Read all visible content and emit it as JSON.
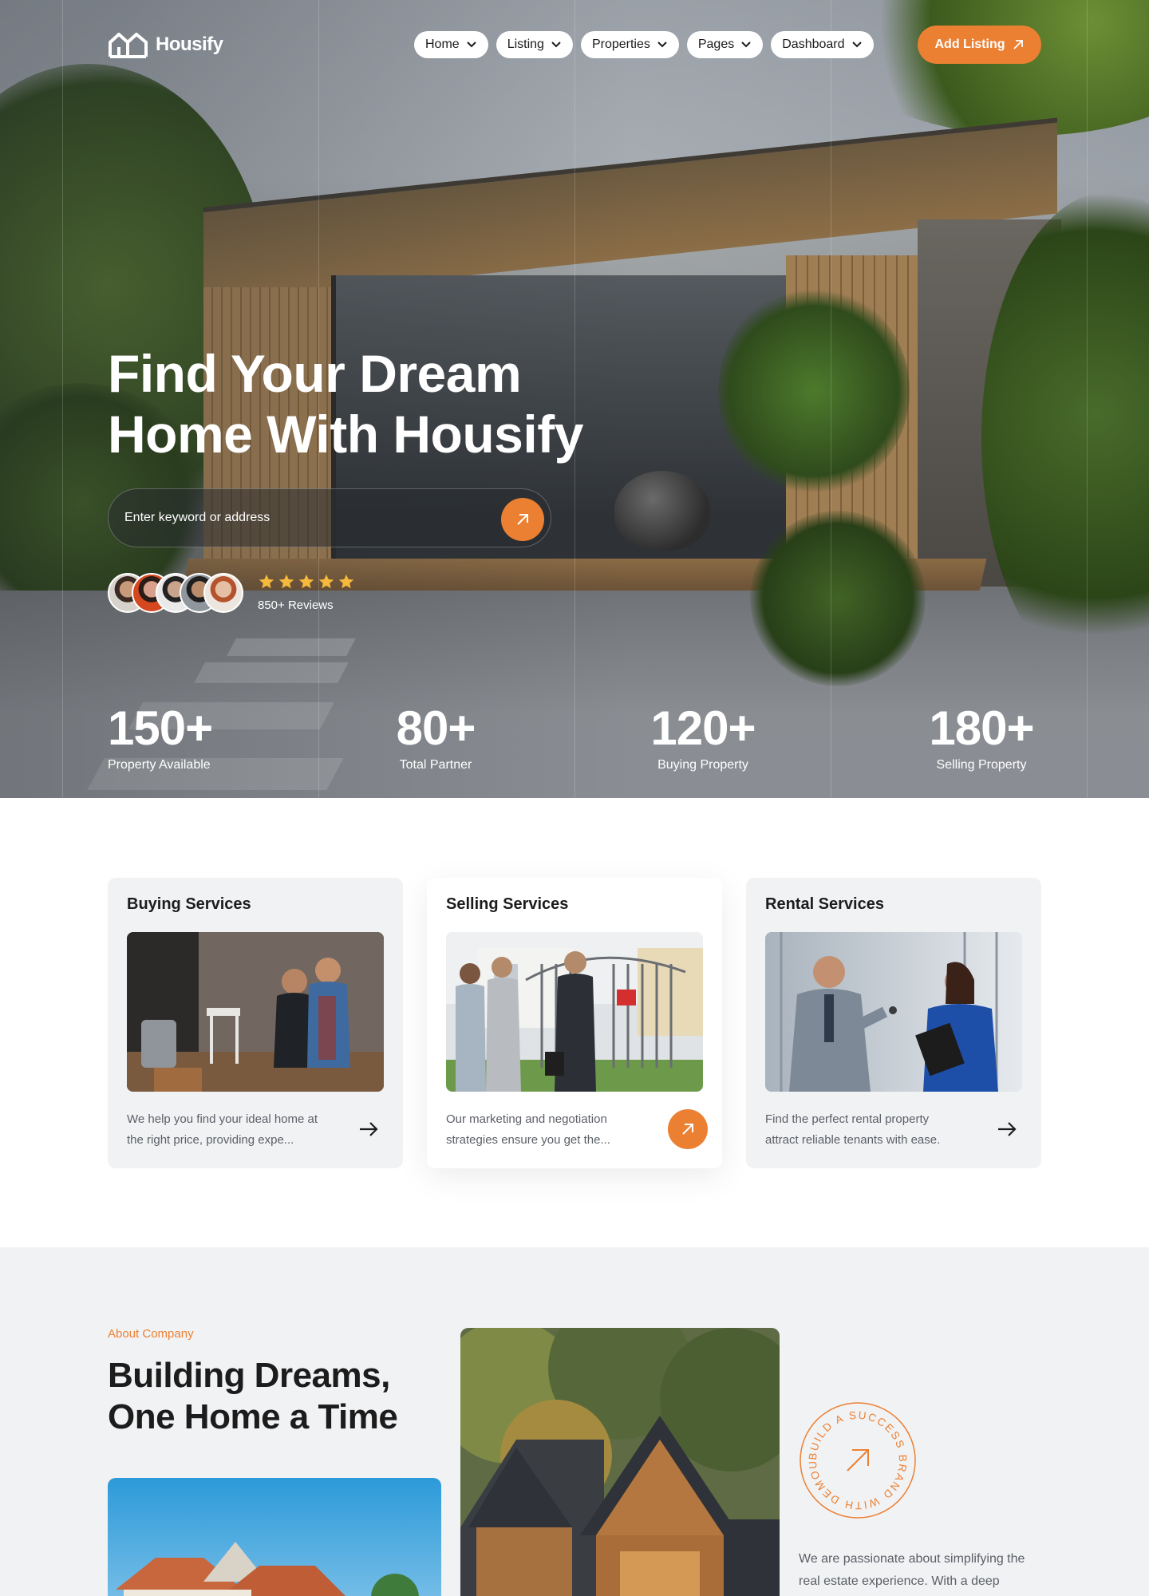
{
  "brand": {
    "name": "Housify",
    "accent": "#ec8032"
  },
  "nav": {
    "items": [
      {
        "label": "Home"
      },
      {
        "label": "Listing"
      },
      {
        "label": "Properties"
      },
      {
        "label": "Pages"
      },
      {
        "label": "Dashboard"
      }
    ],
    "cta_label": "Add Listing"
  },
  "hero": {
    "title_line1": "Find Your Dream",
    "title_line2": "Home With Housify",
    "search_placeholder": "Enter keyword or address",
    "rating_stars": 5,
    "reviews_label": "850+ Reviews"
  },
  "stats": [
    {
      "value": "150+",
      "label": "Property Available"
    },
    {
      "value": "80+",
      "label": "Total Partner"
    },
    {
      "value": "120+",
      "label": "Buying Property"
    },
    {
      "value": "180+",
      "label": "Selling Property"
    }
  ],
  "services": [
    {
      "title": "Buying Services",
      "text_line1": "We help you find your ideal home at",
      "text_line2": "the right price, providing expe...",
      "icon": "arrow-right-icon"
    },
    {
      "title": "Selling Services",
      "text_line1": "Our marketing and negotiation",
      "text_line2": "strategies ensure you get the...",
      "icon": "arrow-up-right-icon"
    },
    {
      "title": "Rental Services",
      "text_line1": "Find the perfect rental property",
      "text_line2": "attract reliable tenants with ease.",
      "icon": "arrow-right-icon"
    }
  ],
  "about": {
    "eyebrow": "About Company",
    "title_line1": "Building Dreams,",
    "title_line2": "One Home a Time",
    "badge_text": "BUILD A SUCCESS BRAND WITH DEMOUI",
    "text_line1": "We are passionate about simplifying the",
    "text_line2": "real estate experience. With a deep"
  }
}
